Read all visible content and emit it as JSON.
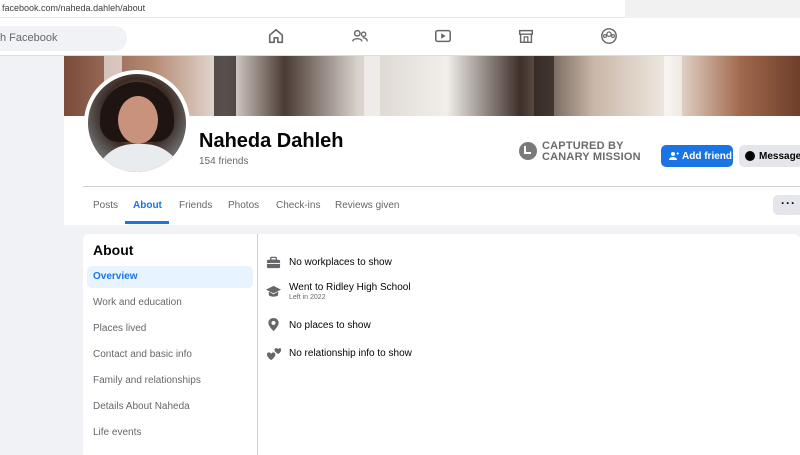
{
  "browser": {
    "url": "facebook.com/naheda.dahleh/about"
  },
  "nav": {
    "search_placeholder": "h Facebook",
    "icons": [
      "home-icon",
      "friends-icon",
      "watch-icon",
      "marketplace-icon",
      "groups-icon"
    ]
  },
  "profile": {
    "name": "Naheda Dahleh",
    "friends": "154 friends",
    "captured_line1": "CAPTURED BY",
    "captured_line2": "CANARY MISSION",
    "add_friend": "Add friend",
    "message": "Message",
    "more": "···"
  },
  "tabs": [
    {
      "label": "Posts"
    },
    {
      "label": "About"
    },
    {
      "label": "Friends"
    },
    {
      "label": "Photos"
    },
    {
      "label": "Check-ins"
    },
    {
      "label": "Reviews given"
    }
  ],
  "about": {
    "title": "About",
    "side": [
      {
        "label": "Overview"
      },
      {
        "label": "Work and education"
      },
      {
        "label": "Places lived"
      },
      {
        "label": "Contact and basic info"
      },
      {
        "label": "Family and relationships"
      },
      {
        "label": "Details About Naheda"
      },
      {
        "label": "Life events"
      }
    ],
    "rows": [
      {
        "icon": "briefcase-icon",
        "text": "No workplaces to show"
      },
      {
        "icon": "graduation-cap-icon",
        "text": "Went to Ridley High School",
        "sub": "Left in 2022"
      },
      {
        "icon": "location-pin-icon",
        "text": "No places to show"
      },
      {
        "icon": "hearts-icon",
        "text": "No relationship info to show"
      }
    ]
  }
}
